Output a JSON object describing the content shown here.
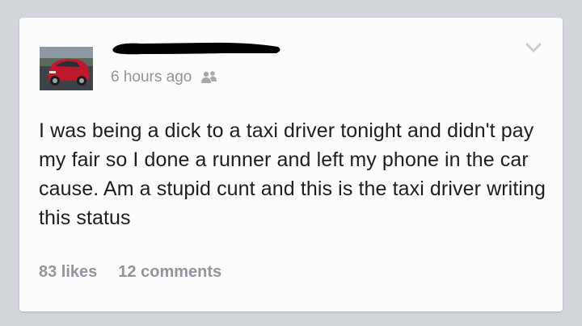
{
  "post": {
    "author_name": "",
    "timestamp": "6 hours ago",
    "audience_icon": "friends-icon",
    "menu_icon": "chevron-down-icon",
    "text": "I was being a dick to a taxi driver tonight and didn't pay my fair so I done a runner and left my phone in the car cause. Am a stupid cunt and this is the taxi driver writing this status",
    "likes_label": "83 likes",
    "comments_label": "12 comments"
  },
  "colors": {
    "page_background": "#d3d6db",
    "card_background": "#fcfcfd",
    "text": "#1c1e21",
    "meta_text": "#90949c",
    "redaction": "#000000",
    "avatar_car": "#c0182b"
  }
}
